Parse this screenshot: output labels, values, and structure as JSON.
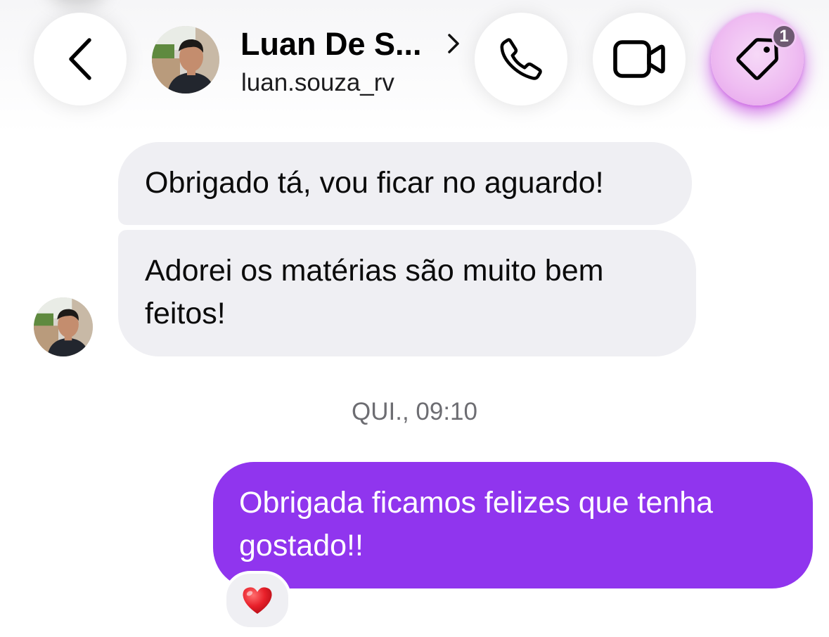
{
  "header": {
    "contact_name": "Luan De S...",
    "contact_handle": "luan.souza_rv",
    "tag_badge_count": "1",
    "icons": {
      "back": "chevron-left-icon",
      "name_link": "chevron-right-icon",
      "call": "phone-icon",
      "video": "video-camera-icon",
      "tag": "tag-icon"
    },
    "tag_highlight_color": "#e07be8"
  },
  "conversation": {
    "incoming": [
      {
        "text": "Obrigado tá, vou ficar no aguardo!"
      },
      {
        "text_line1": "Adorei os matérias são muito bem",
        "text_line2": "feitos!"
      }
    ],
    "timestamp": "QUI., 09:10",
    "outgoing": [
      {
        "text_line1": "Obrigada ficamos felizes que tenha",
        "text_line2": "gostado!!",
        "reaction": "❤️"
      }
    ]
  },
  "colors": {
    "outgoing_bubble": "#9035ee",
    "incoming_bubble": "#efeff3",
    "timestamp_text": "#6d6d72"
  }
}
